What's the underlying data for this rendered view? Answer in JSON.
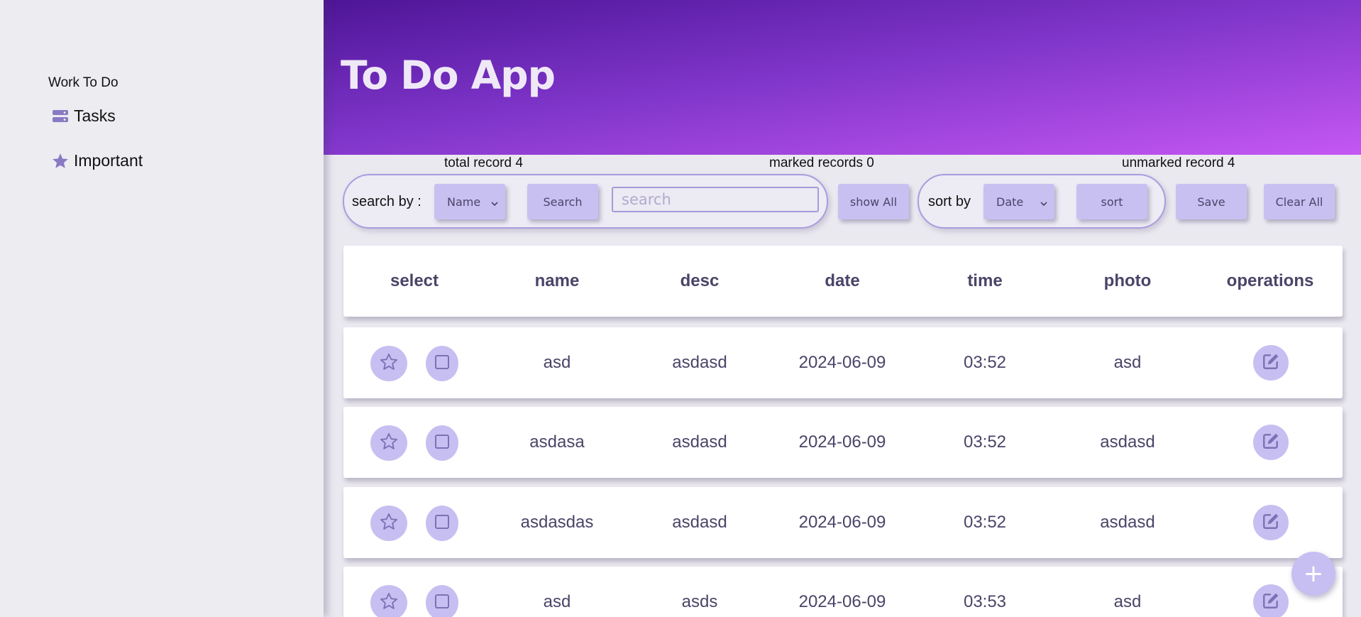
{
  "sidebar": {
    "app_label": "Work To Do",
    "items": [
      {
        "label": "Tasks",
        "icon": "server-icon"
      },
      {
        "label": "Important",
        "icon": "star-icon"
      }
    ]
  },
  "header": {
    "title": "To Do App"
  },
  "counters": {
    "total": "total record 4",
    "marked": "marked records 0",
    "unmarked": "unmarked record 4"
  },
  "toolbar": {
    "search_by_label": "search by :",
    "search_field_select": "Name",
    "search_button": "Search",
    "search_placeholder": "search",
    "show_all_button": "show All",
    "sort_by_label": "sort by",
    "sort_field_select": "Date",
    "sort_button": "sort",
    "save_button": "Save",
    "clear_all_button": "Clear All"
  },
  "table": {
    "headers": [
      "select",
      "name",
      "desc",
      "date",
      "time",
      "photo",
      "operations"
    ],
    "rows": [
      {
        "name": "asd",
        "desc": "asdasd",
        "date": "2024-06-09",
        "time": "03:52",
        "photo": "asd"
      },
      {
        "name": "asdasa",
        "desc": "asdasd",
        "date": "2024-06-09",
        "time": "03:52",
        "photo": "asdasd"
      },
      {
        "name": "asdasdas",
        "desc": "asdasd",
        "date": "2024-06-09",
        "time": "03:52",
        "photo": "asdasd"
      },
      {
        "name": "asd",
        "desc": "asds",
        "date": "2024-06-09",
        "time": "03:53",
        "photo": "asd"
      }
    ]
  },
  "fab": {
    "label": "+"
  },
  "colors": {
    "accent": "#c7bff1",
    "header_gradient_start": "#4e1597",
    "header_gradient_end": "#c557f4",
    "icon": "#8a7ac4"
  }
}
